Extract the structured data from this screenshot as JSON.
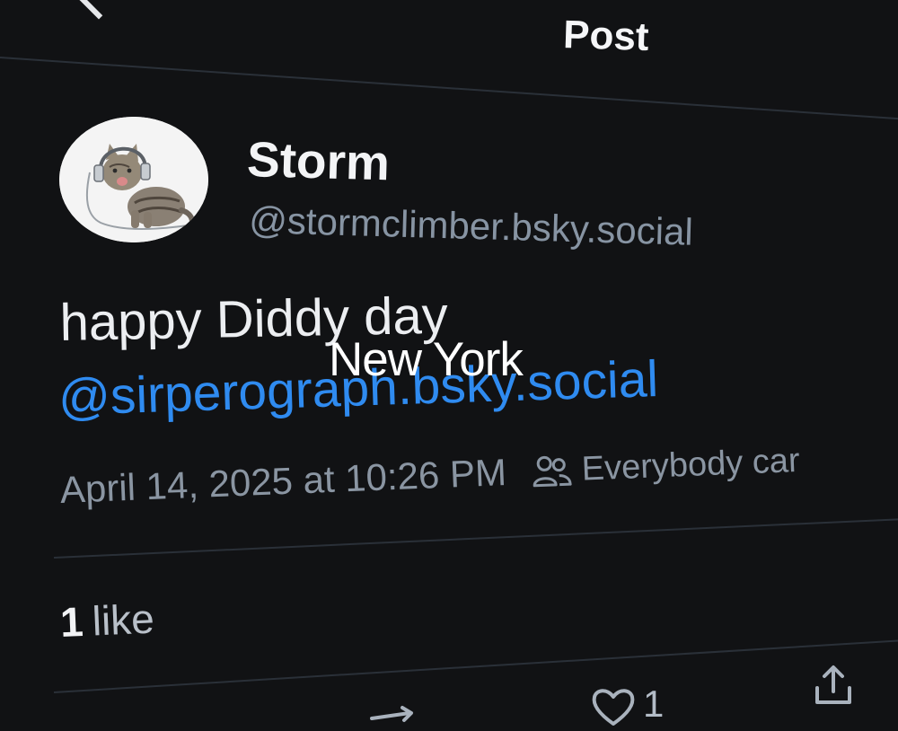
{
  "header": {
    "title": "Post",
    "back_icon": "chevron-left-icon"
  },
  "post": {
    "author": {
      "name": "Storm",
      "handle": "@stormclimber.bsky.social",
      "avatar": "cat-with-headphones"
    },
    "text": "happy Diddy day",
    "mention": "@sirperograph.bsky.social",
    "timestamp": "April 14, 2025 at 10:26 PM",
    "audience": "Everybody car",
    "audience_icon": "people-icon",
    "likes": {
      "count": "1",
      "label": "like"
    }
  },
  "overlay": {
    "caption": "New York"
  },
  "actions": {
    "repost_icon": "repost-icon",
    "like_icon": "heart-icon",
    "like_count": "1",
    "share_icon": "share-icon"
  },
  "colors": {
    "background": "#111214",
    "accent_link": "#2f8bf0",
    "muted_text": "#8a95a2"
  }
}
